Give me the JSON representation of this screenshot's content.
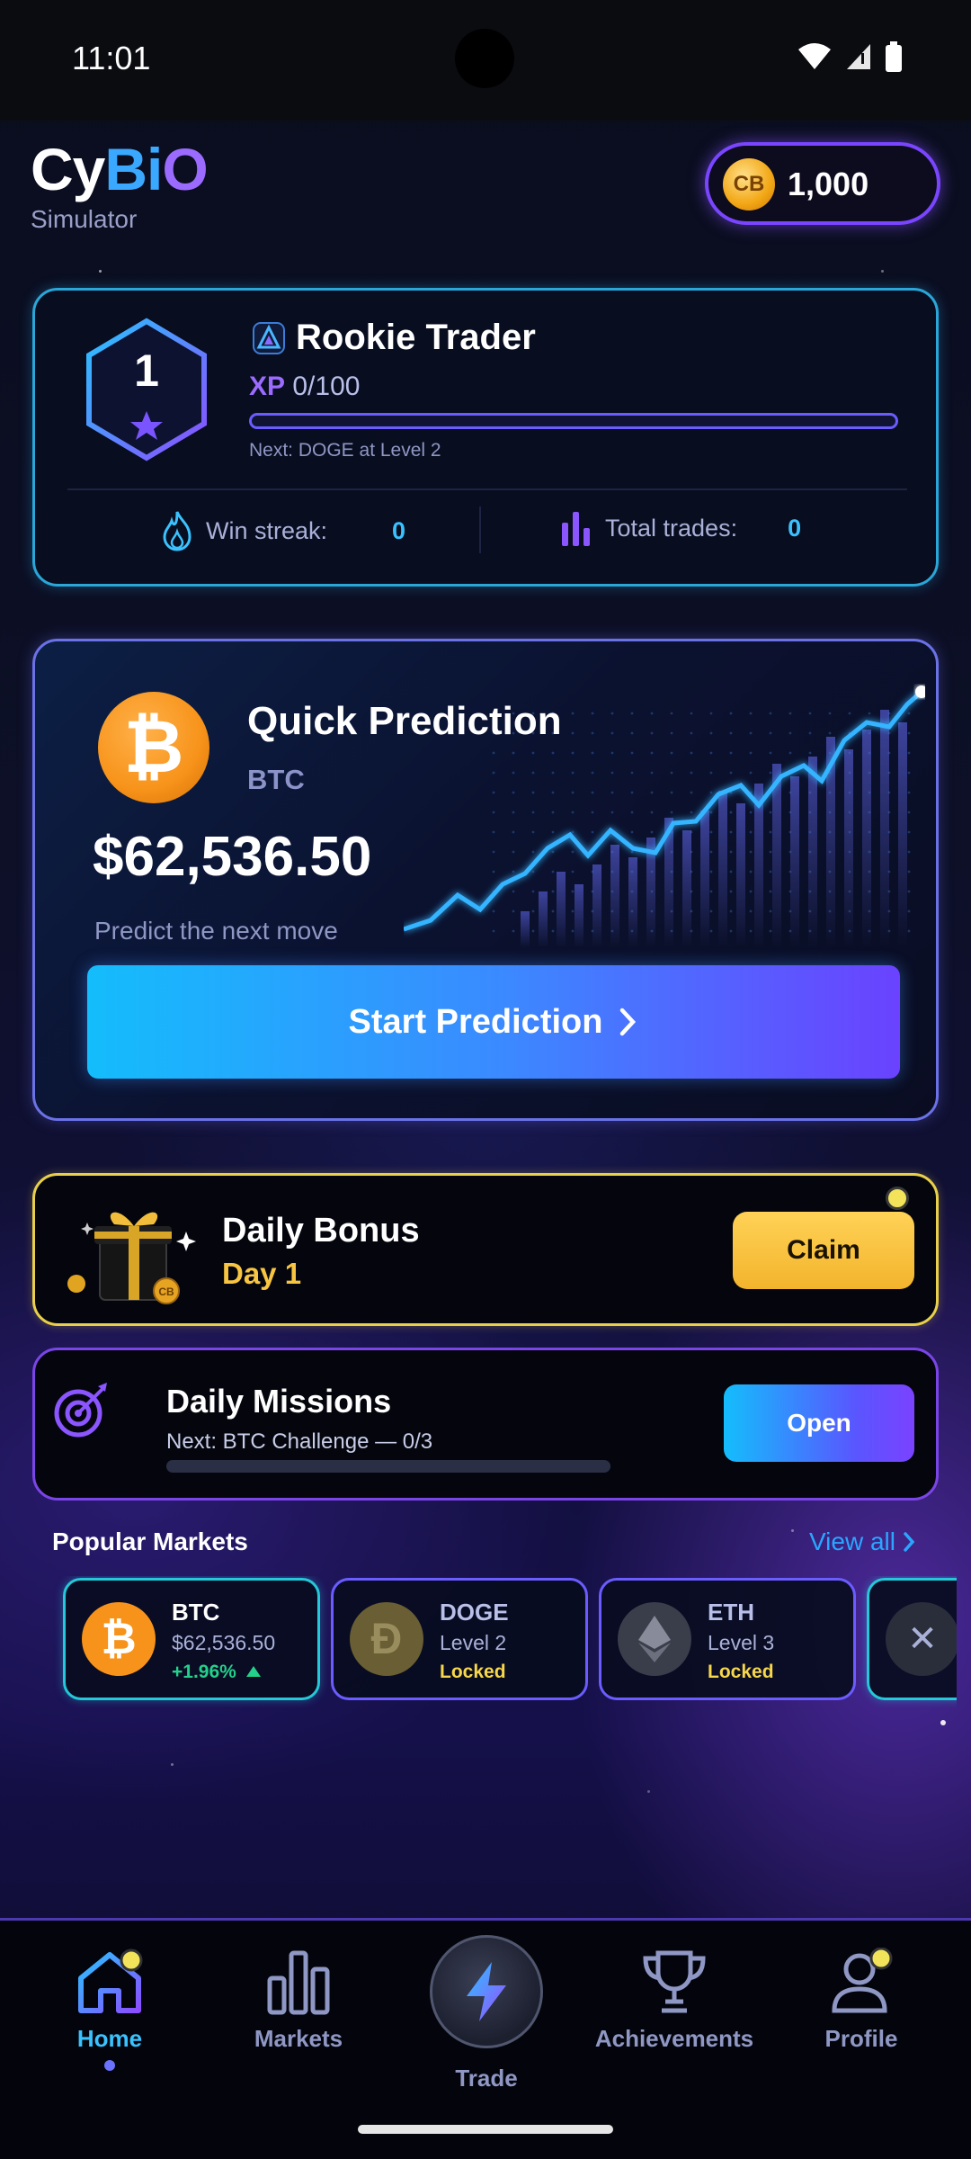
{
  "status_bar": {
    "time": "11:01"
  },
  "header": {
    "logo_part1": "Cy",
    "logo_part2": "Bi",
    "logo_part3": "O",
    "subtitle": "Simulator",
    "coin_symbol": "CB",
    "coin_balance": "1,000"
  },
  "level_card": {
    "level": "1",
    "title": "Rookie Trader",
    "xp_label": "XP",
    "xp_value": "0/100",
    "xp_progress": 0,
    "next_unlock": "Next: DOGE at Level 2",
    "win_streak_label": "Win streak:",
    "win_streak_value": "0",
    "total_trades_label": "Total trades:",
    "total_trades_value": "0"
  },
  "quick_prediction": {
    "title": "Quick Prediction",
    "symbol": "BTC",
    "price": "$62,536.50",
    "hint": "Predict the next move",
    "button_label": "Start Prediction"
  },
  "daily_bonus": {
    "title": "Daily Bonus",
    "day": "Day 1",
    "button_label": "Claim"
  },
  "daily_missions": {
    "title": "Daily Missions",
    "subtitle": "Next: BTC Challenge — 0/3",
    "progress": 0,
    "button_label": "Open"
  },
  "popular_markets": {
    "title": "Popular Markets",
    "view_all": "View all",
    "items": [
      {
        "symbol": "BTC",
        "price": "$62,536.50",
        "change": "+1.96%",
        "icon": "bitcoin-icon",
        "color": "#f7931a"
      },
      {
        "symbol": "DOGE",
        "level": "Level 2",
        "status": "Locked",
        "icon": "dogecoin-icon",
        "color": "#8a7a3a"
      },
      {
        "symbol": "ETH",
        "level": "Level 3",
        "status": "Locked",
        "icon": "ethereum-icon",
        "color": "#3a3d4a"
      }
    ]
  },
  "nav": {
    "items": [
      {
        "label": "Home",
        "icon": "home-icon",
        "active": true
      },
      {
        "label": "Markets",
        "icon": "bar-chart-icon"
      },
      {
        "label": "Trade",
        "icon": "lightning-icon"
      },
      {
        "label": "Achievements",
        "icon": "trophy-icon"
      },
      {
        "label": "Profile",
        "icon": "user-icon"
      }
    ]
  },
  "colors": {
    "accent_cyan": "#3ac2ff",
    "accent_purple": "#7a45ff",
    "gold": "#f7c542",
    "positive": "#23d18b"
  }
}
